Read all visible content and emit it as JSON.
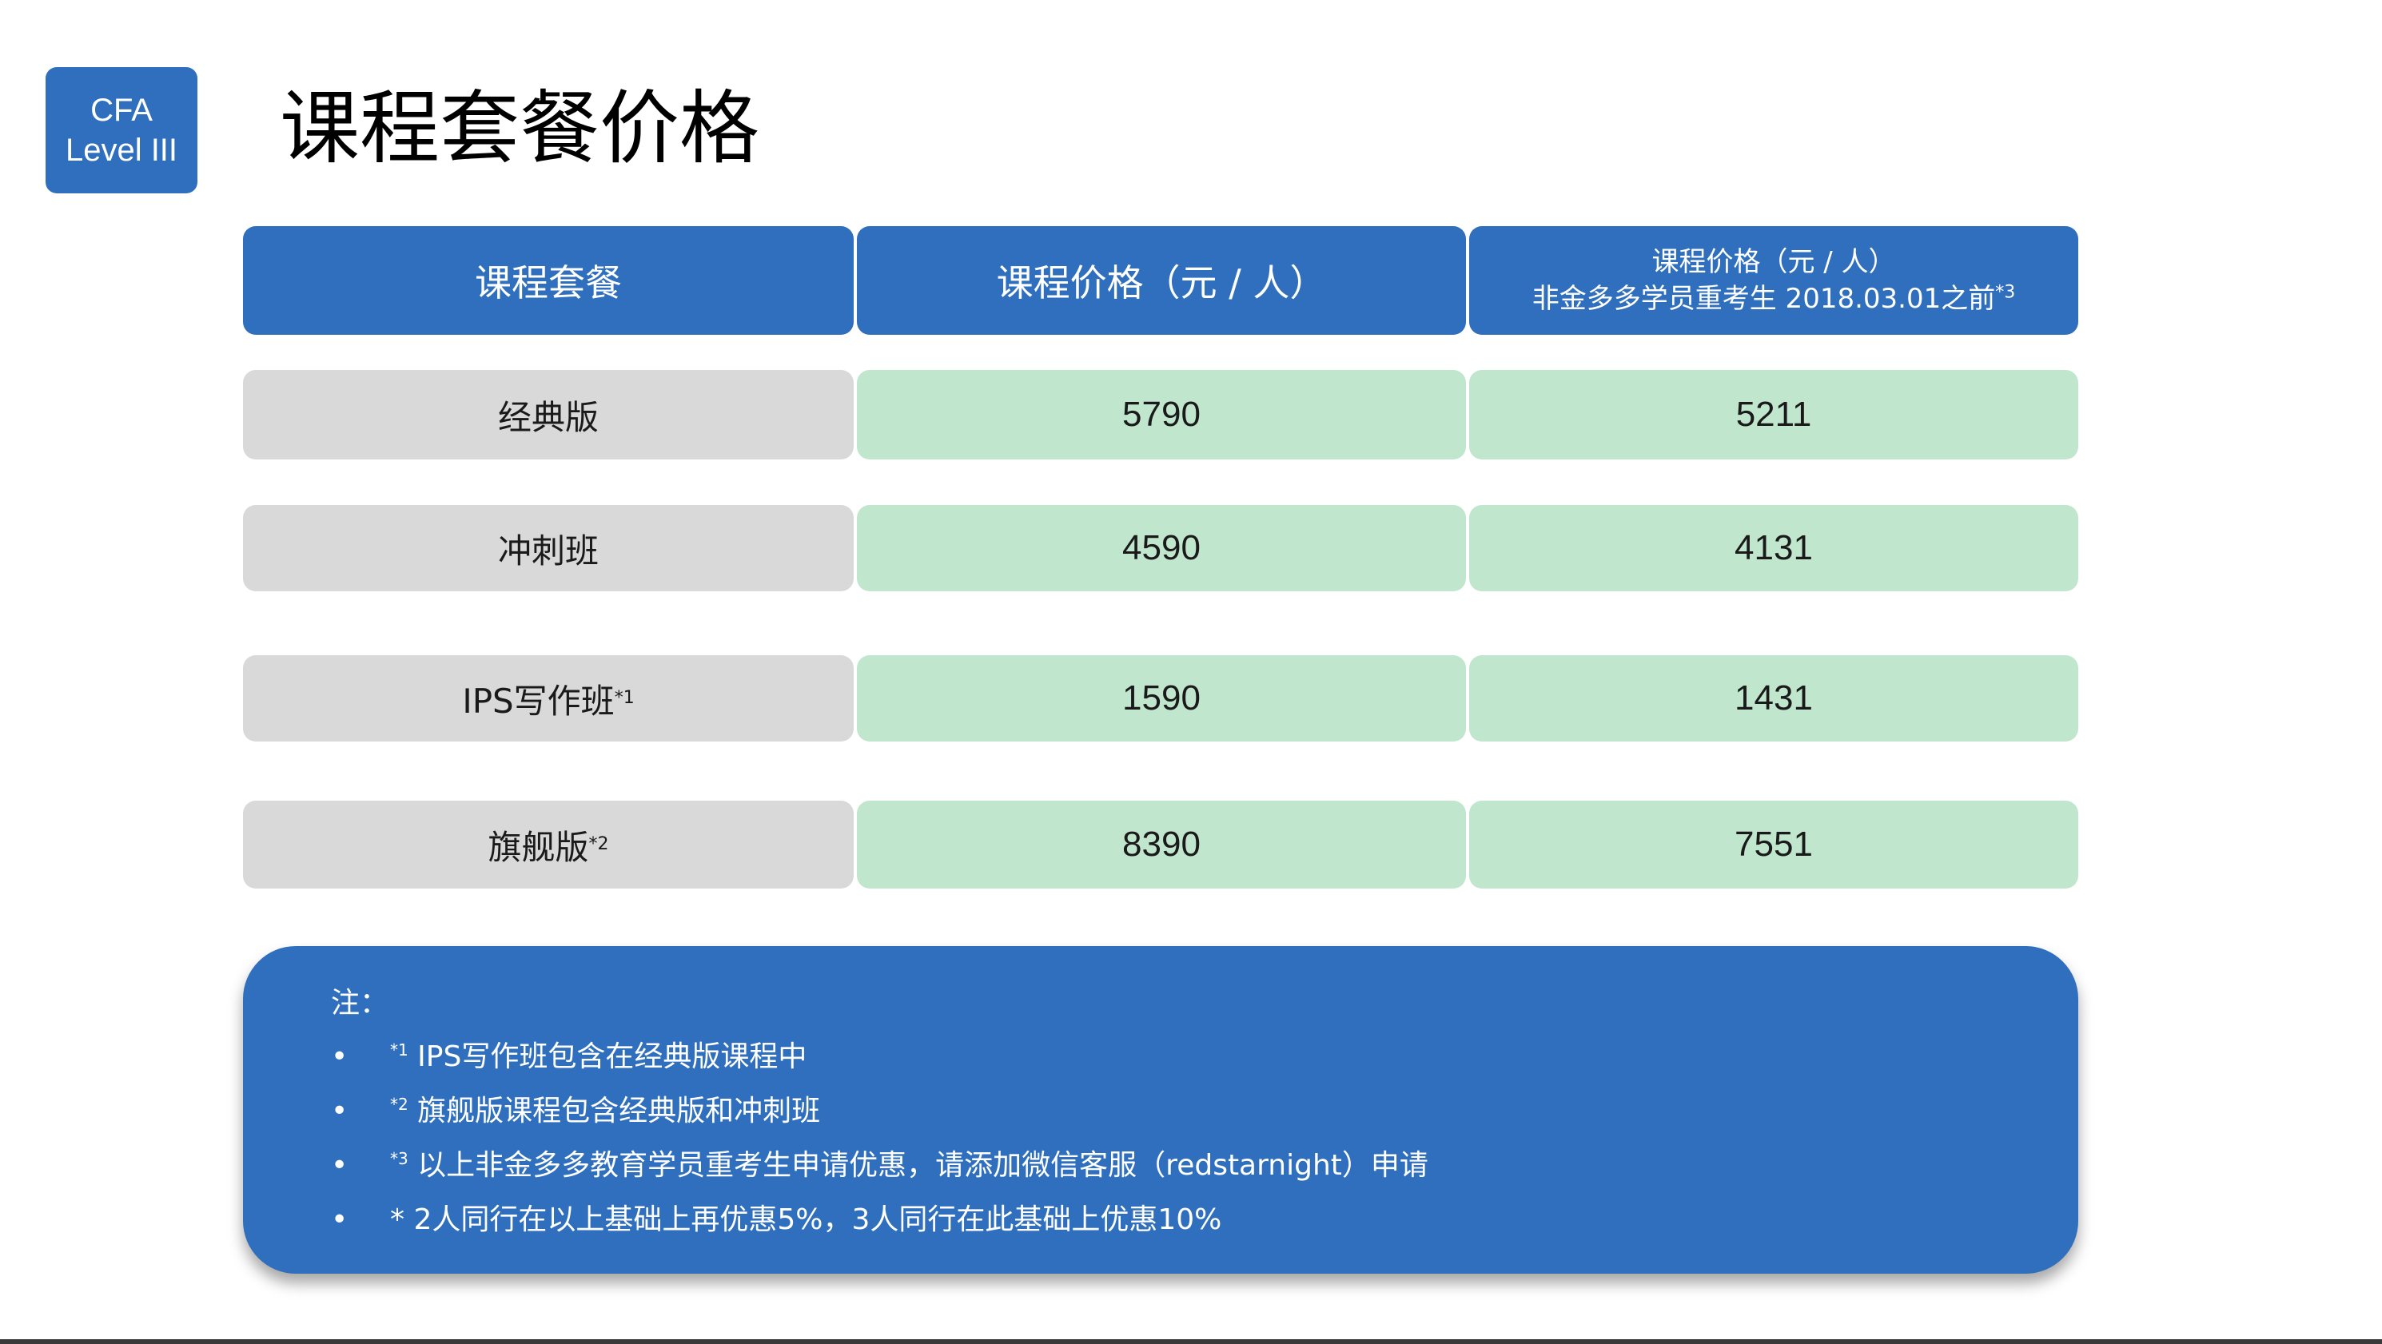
{
  "badge": {
    "line1": "CFA",
    "line2": "Level III"
  },
  "title": "课程套餐价格",
  "table": {
    "headers": {
      "package": "课程套餐",
      "price": "课程价格（元 / 人）",
      "discount_line1": "课程价格（元 / 人）",
      "discount_line2": "非金多多学员重考生 2018.03.01之前",
      "discount_mark": "*3"
    },
    "rows": [
      {
        "name": "经典版",
        "mark": "",
        "price": "5790",
        "discount": "5211"
      },
      {
        "name": "冲刺班",
        "mark": "",
        "price": "4590",
        "discount": "4131"
      },
      {
        "name": "IPS写作班",
        "mark": "*1",
        "price": "1590",
        "discount": "1431"
      },
      {
        "name": "旗舰版",
        "mark": "*2",
        "price": "8390",
        "discount": "7551"
      }
    ]
  },
  "notes": {
    "title": "注：",
    "bullet": "•",
    "items": [
      {
        "mark": "*1",
        "text": " IPS写作班包含在经典版课程中"
      },
      {
        "mark": "*2",
        "text": " 旗舰版课程包含经典版和冲刺班"
      },
      {
        "mark": "*3",
        "text": " 以上非金多多教育学员重考生申请优惠，请添加微信客服（redstarnight）申请"
      },
      {
        "mark": "",
        "text": "* 2人同行在以上基础上再优惠5%，3人同行在此基础上优惠10%"
      }
    ]
  },
  "colors": {
    "header_blue": "#2f6fbd",
    "name_gray": "#d9d9d9",
    "price_green": "#c0e6cd"
  }
}
